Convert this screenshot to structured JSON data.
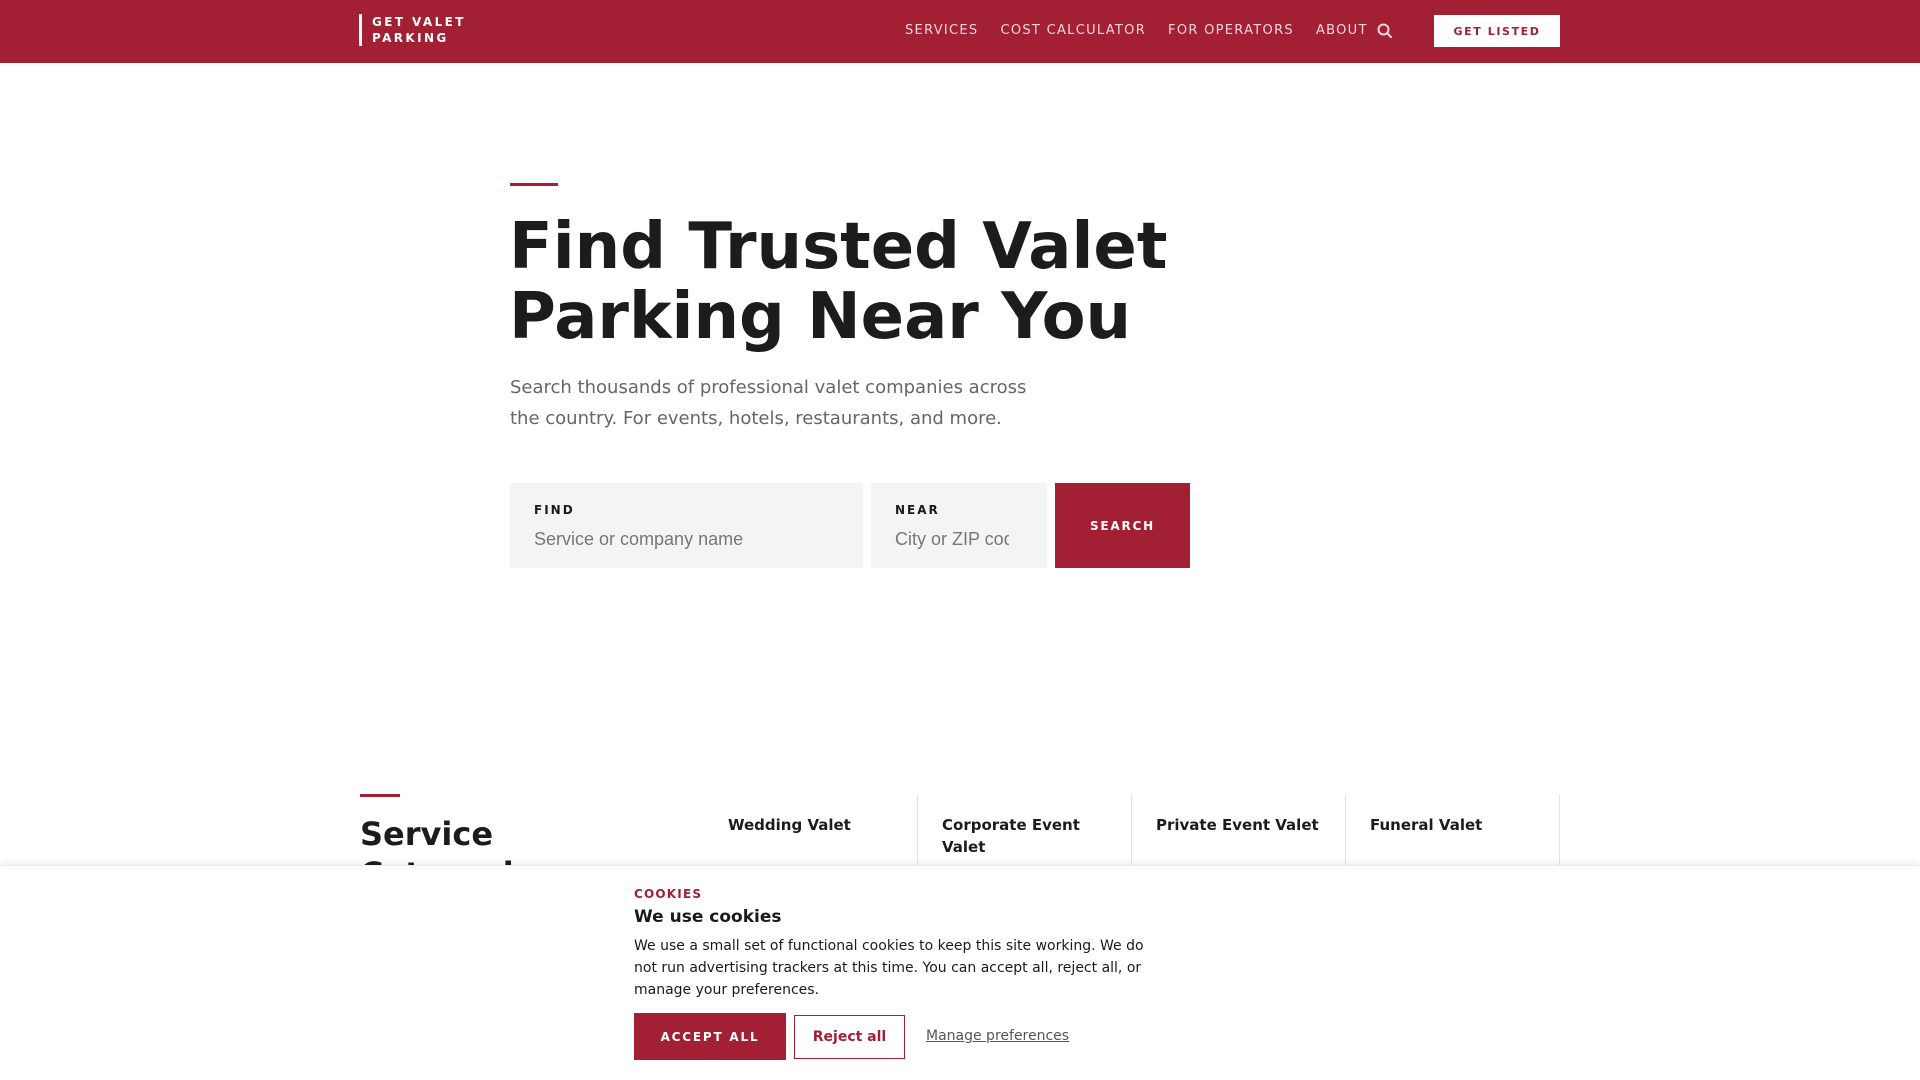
{
  "header": {
    "logo_line1": "GET VALET",
    "logo_line2": "PARKING",
    "nav": [
      "SERVICES",
      "COST CALCULATOR",
      "FOR OPERATORS",
      "ABOUT"
    ],
    "cta_label": "GET LISTED",
    "search_icon": "search-icon"
  },
  "hero": {
    "title_line1": "Find Trusted Valet",
    "title_line2": "Parking Near You",
    "subtitle_line1": "Search thousands of professional valet companies across",
    "subtitle_line2": "the country. For events, hotels, restaurants, and more.",
    "find_label": "FIND",
    "find_placeholder": "Service or company name",
    "near_label": "NEAR",
    "near_placeholder": "City or ZIP code",
    "search_button": "SEARCH"
  },
  "categories": {
    "title_line1": "Service",
    "title_line2": "Categories",
    "items": [
      "Wedding Valet",
      "Corporate Event Valet",
      "Private Event Valet",
      "Funeral Valet"
    ]
  },
  "cookie": {
    "eyebrow": "COOKIES",
    "title": "We use cookies",
    "text": "We use a small set of functional cookies to keep this site working. We do not run advertising trackers at this time. You can accept all, reject all, or manage your preferences.",
    "accept": "ACCEPT ALL",
    "reject": "Reject all",
    "manage": "Manage preferences"
  },
  "colors": {
    "brand": "#a31f34",
    "field_bg": "#f4f4f4",
    "muted_text": "#666666"
  }
}
